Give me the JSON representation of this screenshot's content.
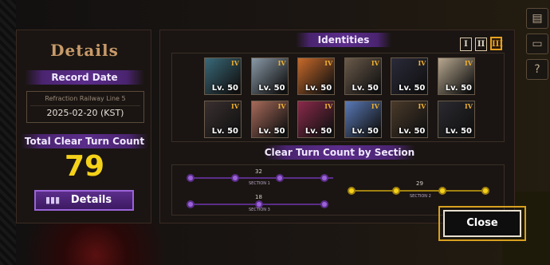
{
  "left_panel": {
    "title": "Details",
    "record_date_header": "Record Date",
    "location": "Refraction Railway Line 5",
    "date": "2025-02-20 (KST)",
    "turn_header": "Total Clear Turn Count",
    "turn_count": "79",
    "details_button": "Details"
  },
  "right_panel": {
    "identities_header": "Identities",
    "tabs": [
      "I",
      "II",
      "III"
    ],
    "active_tab": "III",
    "identities": [
      {
        "tier": "IV",
        "level": "Lv. 50",
        "color": "#3a6a7a"
      },
      {
        "tier": "IV",
        "level": "Lv. 50",
        "color": "#8a9aa8"
      },
      {
        "tier": "IV",
        "level": "Lv. 50",
        "color": "#c86a2a"
      },
      {
        "tier": "IV",
        "level": "Lv. 50",
        "color": "#6a5a4a"
      },
      {
        "tier": "IV",
        "level": "Lv. 50",
        "color": "#2a2a3a"
      },
      {
        "tier": "IV",
        "level": "Lv. 50",
        "color": "#b8a890"
      },
      {
        "tier": "IV",
        "level": "Lv. 50",
        "color": "#3a3030"
      },
      {
        "tier": "IV",
        "level": "Lv. 50",
        "color": "#a86a5a"
      },
      {
        "tier": "IV",
        "level": "Lv. 50",
        "color": "#8a2a4a"
      },
      {
        "tier": "IV",
        "level": "Lv. 50",
        "color": "#5a7ab8"
      },
      {
        "tier": "IV",
        "level": "Lv. 50",
        "color": "#4a3a2a"
      },
      {
        "tier": "IV",
        "level": "Lv. 50",
        "color": "#2a2a30"
      }
    ],
    "section_header": "Clear Turn Count by Section",
    "sections": [
      {
        "turns": "32",
        "label": "SECTION 1",
        "color": "#9b63d8"
      },
      {
        "turns": "29",
        "label": "SECTION 2",
        "color": "#f5d21a"
      },
      {
        "turns": "18",
        "label": "SECTION 3",
        "color": "#9b63d8"
      }
    ]
  },
  "close_button": "Close"
}
